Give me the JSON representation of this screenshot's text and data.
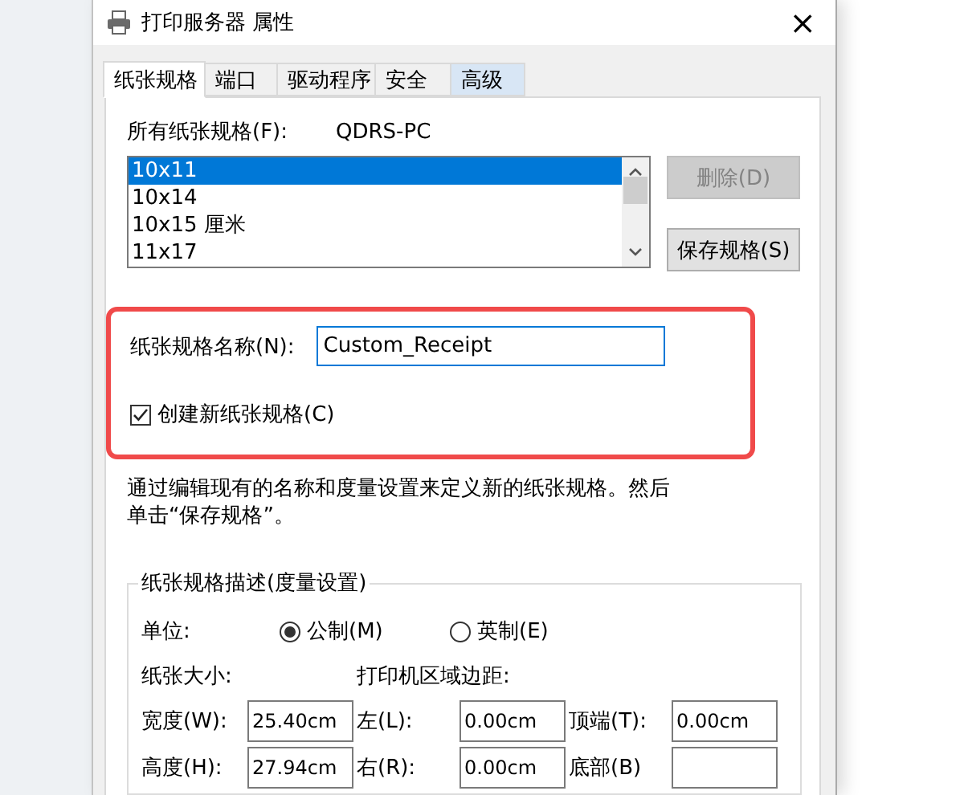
{
  "window": {
    "title": "打印服务器 属性",
    "close": "×"
  },
  "tabs": [
    {
      "label": "纸张规格",
      "selected": true,
      "hovered": false
    },
    {
      "label": "端口",
      "selected": false,
      "hovered": false
    },
    {
      "label": "驱动程序",
      "selected": false,
      "hovered": false
    },
    {
      "label": "安全",
      "selected": false,
      "hovered": false
    },
    {
      "label": "高级",
      "selected": false,
      "hovered": true
    }
  ],
  "forms_list": {
    "label": "所有纸张规格(F):",
    "server": "QDRS-PC",
    "items": [
      {
        "label": "10x11",
        "selected": true
      },
      {
        "label": "10x14",
        "selected": false
      },
      {
        "label": "10x15 厘米",
        "selected": false
      },
      {
        "label": "11x17",
        "selected": false
      }
    ]
  },
  "buttons": [
    {
      "label": "删除(D)",
      "disabled": true
    },
    {
      "label": "保存规格(S)",
      "disabled": false
    }
  ],
  "new_form": {
    "highlighted": true,
    "name_label": "纸张规格名称(N):",
    "name_value": "Custom_Receipt",
    "create_label": "创建新纸张规格(C)",
    "create_checked": true
  },
  "description": "通过编辑现有的名称和度量设置来定义新的纸张规格。然后单击“保存规格”。",
  "measurements": {
    "title": "纸张规格描述(度量设置)",
    "units_label": "单位:",
    "units": [
      {
        "label": "公制(M)",
        "selected": true
      },
      {
        "label": "英制(E)",
        "selected": false
      }
    ],
    "paper_size_label": "纸张大小:",
    "margins_label": "打印机区域边距:",
    "rows": [
      [
        {
          "label": "宽度(W):",
          "value": "25.40cm"
        },
        {
          "label": "左(L):",
          "value": "0.00cm"
        },
        {
          "label": "顶端(T):",
          "value": "0.00cm"
        }
      ],
      [
        {
          "label": "高度(H):",
          "value": "27.94cm"
        },
        {
          "label": "右(R):",
          "value": "0.00cm"
        },
        {
          "label": "底部(B)"
        }
      ]
    ]
  }
}
